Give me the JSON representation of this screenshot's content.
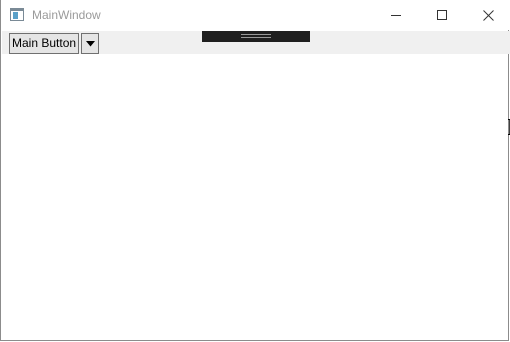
{
  "window": {
    "title": "MainWindow"
  },
  "toolbar": {
    "main_button_label": "Main Button"
  },
  "icons": {
    "app": "app-window-icon",
    "minimize": "minimize-icon",
    "maximize": "maximize-icon",
    "close": "close-icon",
    "dropdown": "chevron-down-icon"
  }
}
